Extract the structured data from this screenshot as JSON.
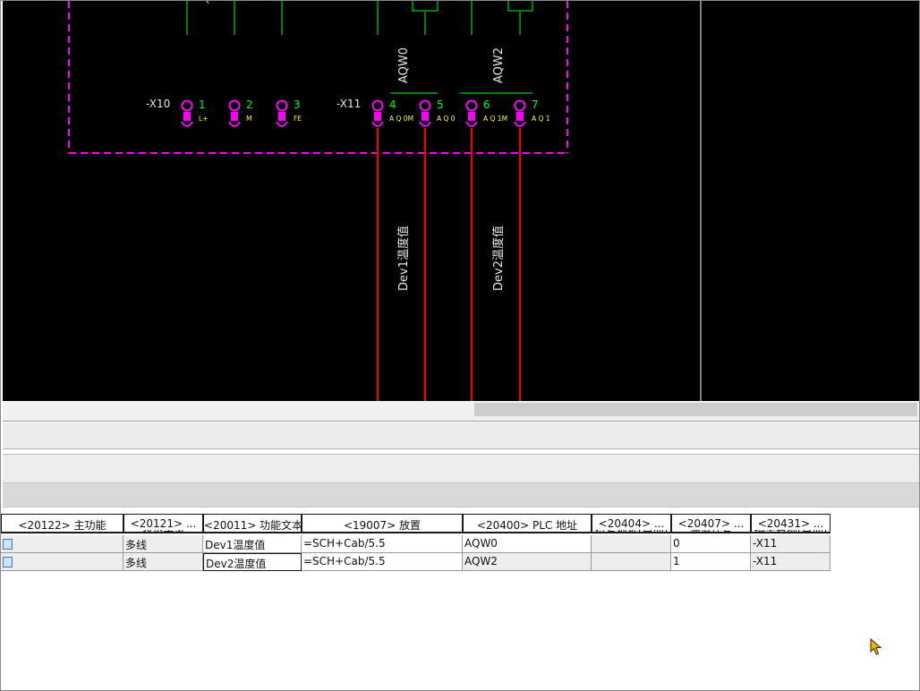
{
  "schematic": {
    "strip_x10": {
      "label": "-X10",
      "terminals": [
        {
          "num": "1",
          "tag": "L+"
        },
        {
          "num": "2",
          "tag": "M"
        },
        {
          "num": "3",
          "tag": "FE"
        }
      ]
    },
    "strip_x11": {
      "label": "-X11",
      "terminals": [
        {
          "num": "4",
          "tag": "A Q 0M"
        },
        {
          "num": "5",
          "tag": "A Q 0"
        },
        {
          "num": "6",
          "tag": "A Q 1M"
        },
        {
          "num": "7",
          "tag": "A Q 1"
        }
      ]
    },
    "channels": [
      "AQW0",
      "AQW2"
    ],
    "wire_labels": [
      "Dev1温度值",
      "Dev2温度值"
    ],
    "colors": {
      "background": "#000000",
      "box_border": "#ff00ff",
      "terminal": "#ff00ff",
      "terminal_number": "#00ff00",
      "terminal_tag": "#ffff00",
      "wire": "#ff0000",
      "channel_line": "#00ff00",
      "text": "#e6e6e6"
    }
  },
  "table": {
    "columns": [
      {
        "title": "<20122> 主功能",
        "subtitle": ""
      },
      {
        "title": "<20121> ...",
        "subtitle": "表达类型"
      },
      {
        "title": "<20011> 功能文本",
        "subtitle": ""
      },
      {
        "title": "<19007> 放置",
        "subtitle": ""
      },
      {
        "title": "<20400> PLC 地址",
        "subtitle": ""
      },
      {
        "title": "<20404> ...",
        "subtitle": "符号地址(自动)"
      },
      {
        "title": "<20407> ...",
        "subtitle": "通道代号"
      },
      {
        "title": "<20431> ...",
        "subtitle": "插头名称(自动)"
      }
    ],
    "rows": [
      [
        "",
        "多线",
        "Dev1温度值",
        "=SCH+Cab/5.5",
        "AQW0",
        "",
        "0",
        "-X11"
      ],
      [
        "",
        "多线",
        "Dev2温度值",
        "=SCH+Cab/5.5",
        "AQW2",
        "",
        "1",
        "-X11"
      ]
    ]
  }
}
